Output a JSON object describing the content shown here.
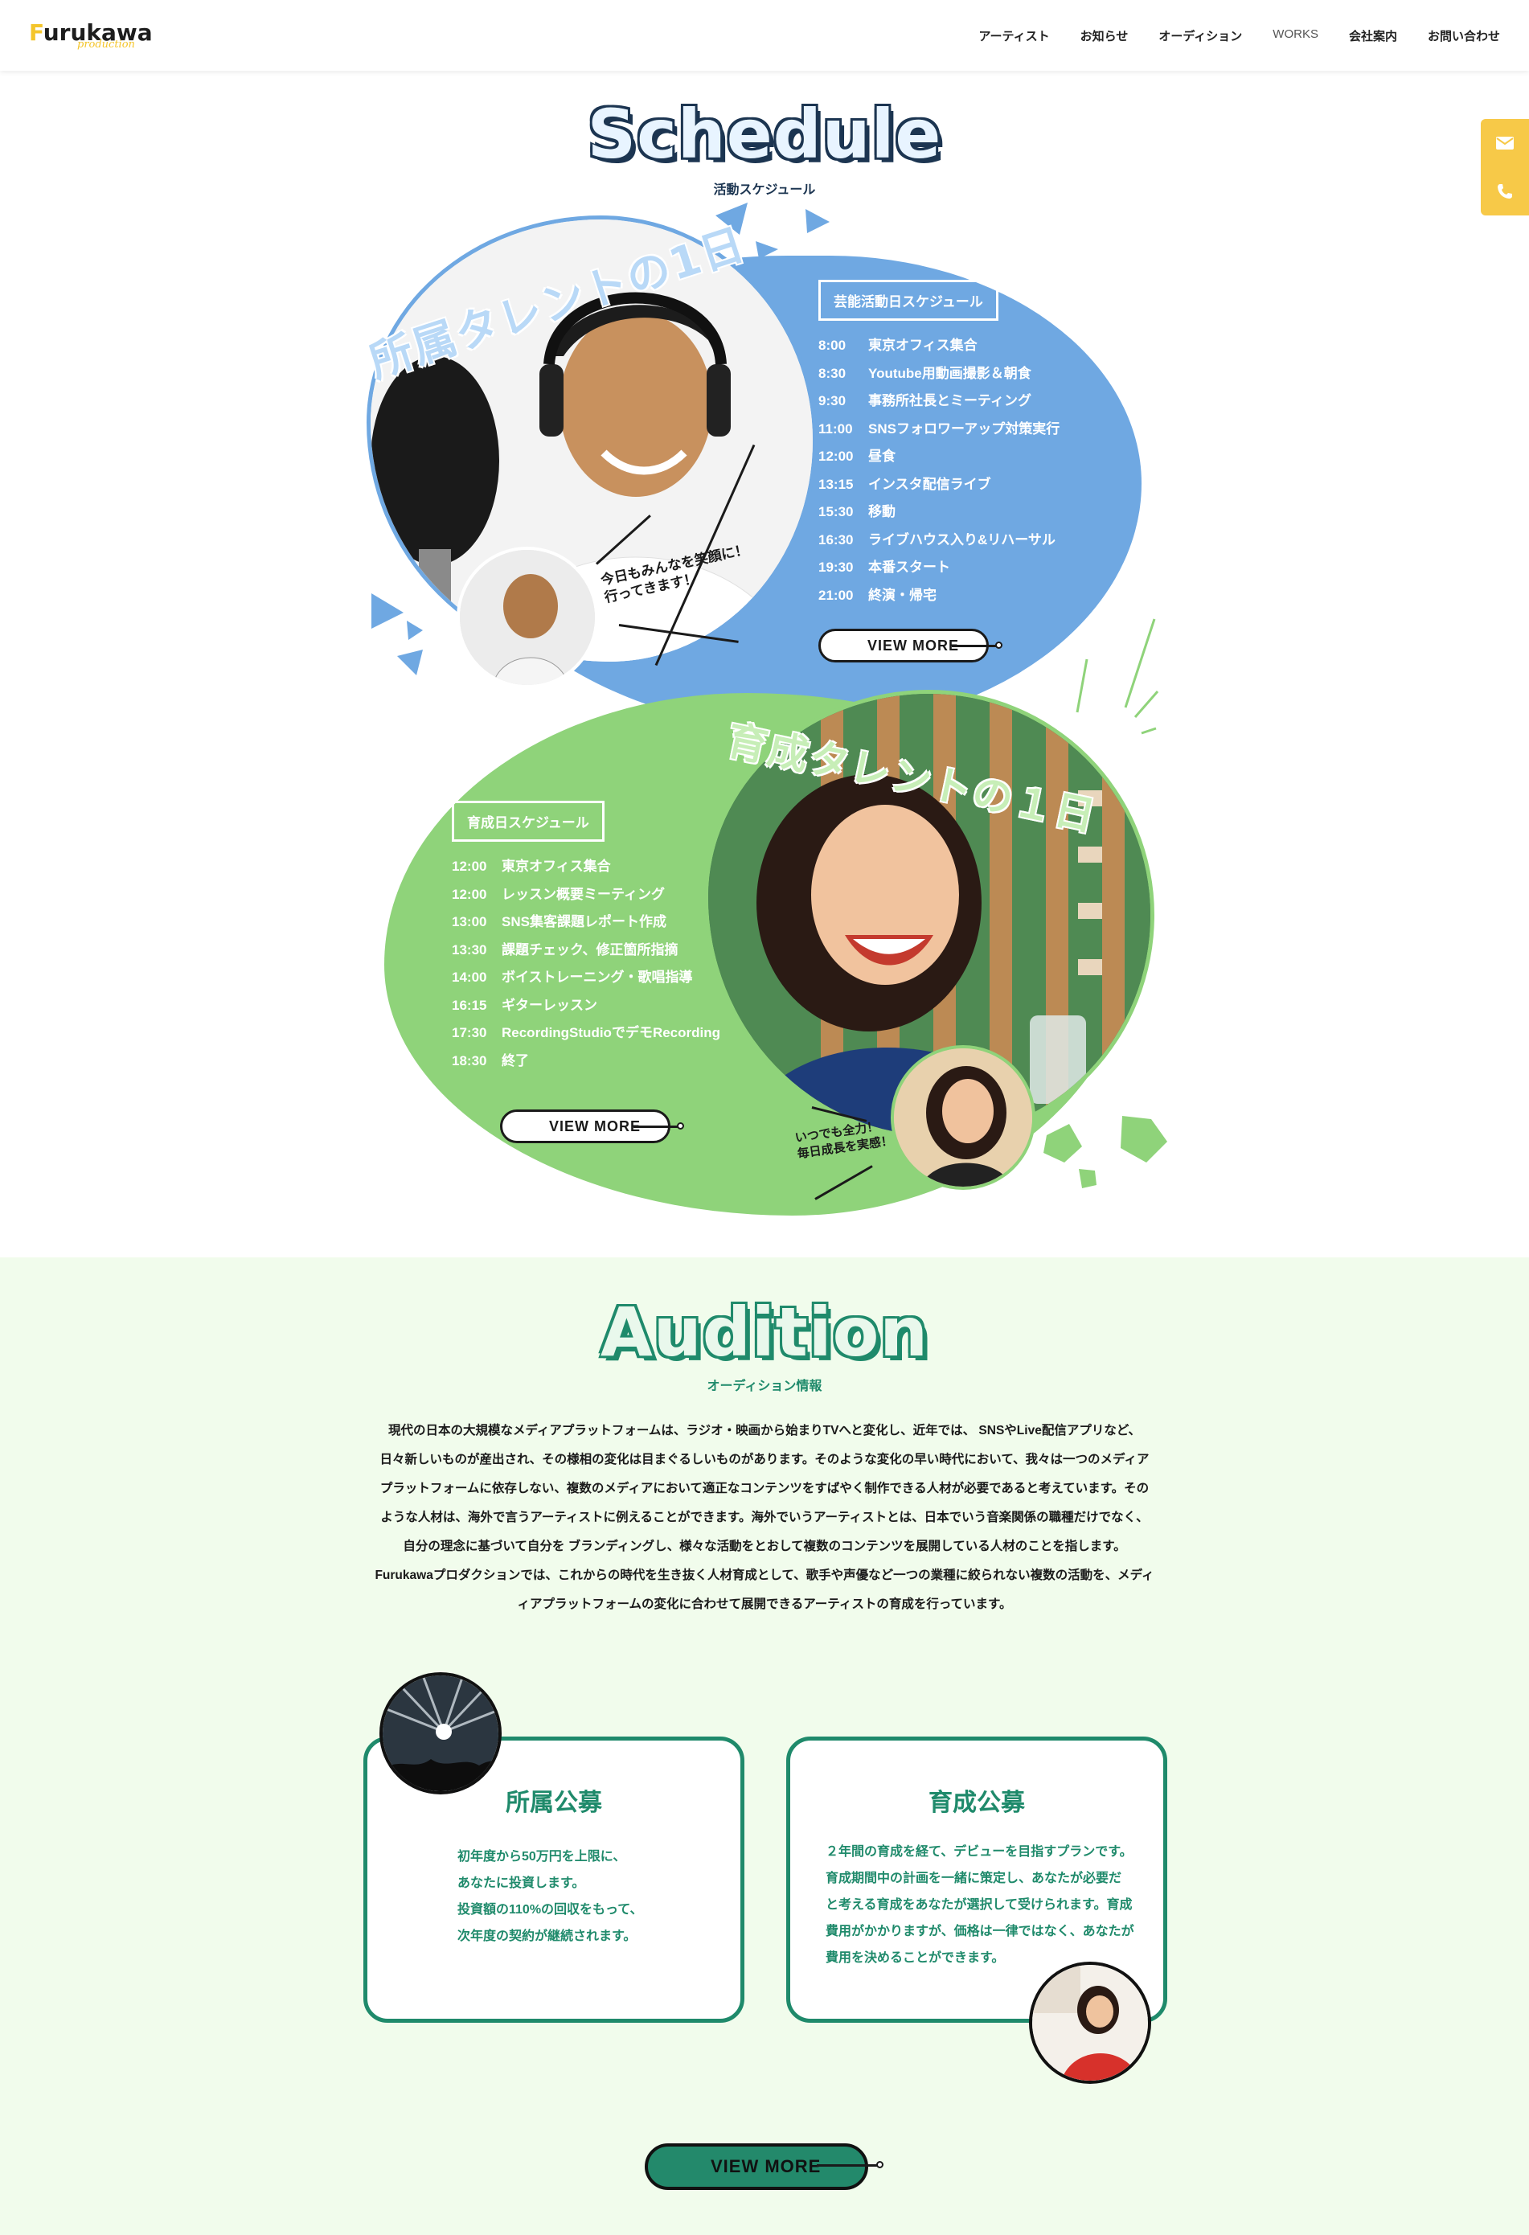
{
  "header": {
    "logo_text": "urukawa",
    "logo_initial": "F",
    "logo_sub": "production",
    "nav": [
      "アーティスト",
      "お知らせ",
      "オーディション",
      "WORKS",
      "会社案内",
      "お問い合わせ"
    ]
  },
  "side_tabs": {
    "mail_icon": "mail-icon",
    "phone_icon": "phone-icon"
  },
  "schedule": {
    "title": "Schedule",
    "subtitle": "活動スケジュール",
    "block1": {
      "headline": "所属タレントの1日",
      "label": "芸能活動日スケジュール",
      "items": [
        {
          "time": "8:00",
          "text": "東京オフィス集合"
        },
        {
          "time": "8:30",
          "text": "Youtube用動画撮影＆朝食"
        },
        {
          "time": "9:30",
          "text": "事務所社長とミーティング"
        },
        {
          "time": "11:00",
          "text": "SNSフォロワーアップ対策実行"
        },
        {
          "time": "12:00",
          "text": "昼食"
        },
        {
          "time": "13:15",
          "text": "インスタ配信ライブ"
        },
        {
          "time": "15:30",
          "text": "移動"
        },
        {
          "time": "16:30",
          "text": "ライブハウス入り&リハーサル"
        },
        {
          "time": "19:30",
          "text": "本番スタート"
        },
        {
          "time": "21:00",
          "text": "終演・帰宅"
        }
      ],
      "speech_line1": "今日もみんなを笑顔に！",
      "speech_line2": "行ってきます！",
      "view_more": "VIEW MORE"
    },
    "block2": {
      "headline": "育成タレントの１日",
      "label": "育成日スケジュール",
      "items": [
        {
          "time": "12:00",
          "text": "東京オフィス集合"
        },
        {
          "time": "12:00",
          "text": "レッスン概要ミーティング"
        },
        {
          "time": "13:00",
          "text": "SNS集客課題レポート作成"
        },
        {
          "time": "13:30",
          "text": "課題チェック、修正箇所指摘"
        },
        {
          "time": "14:00",
          "text": "ボイストレーニング・歌唱指導"
        },
        {
          "time": "16:15",
          "text": "ギターレッスン"
        },
        {
          "time": "17:30",
          "text": "RecordingStudioでデモRecording"
        },
        {
          "time": "18:30",
          "text": "終了"
        }
      ],
      "speech_line1": "いつでも全力！",
      "speech_line2": "毎日成長を実感！",
      "view_more": "VIEW MORE"
    }
  },
  "audition": {
    "title": "Audition",
    "subtitle": "オーディション情報",
    "body": [
      "現代の日本の大規模なメディアプラットフォームは、ラジオ・映画から始まりTVへと変化し、近年では、 SNSやLive配信アプリなど、",
      "日々新しいものが産出され、その様相の変化は目まぐるしいものがあります。そのような変化の早い時代において、我々は一つのメディア",
      "プラットフォームに依存しない、複数のメディアにおいて適正なコンテンツをすばやく制作できる人材が必要であると考えています。その",
      "ような人材は、海外で言うアーティストに例えることができます。海外でいうアーティストとは、日本でいう音楽関係の職種だけでなく、",
      "自分の理念に基づいて自分を ブランディングし、様々な活動をとおして複数のコンテンツを展開している人材のことを指します。",
      "Furukawaプロダクションでは、これからの時代を生き抜く人材育成として、歌手や声優など一つの業種に絞られない複数の活動を、メディ",
      "ィアプラットフォームの変化に合わせて展開できるアーティストの育成を行っています。"
    ],
    "card1": {
      "title": "所属公募",
      "lines": [
        "初年度から50万円を上限に、",
        "あなたに投資します。",
        "投資額の110%の回収をもって、",
        "次年度の契約が継続されます。"
      ]
    },
    "card2": {
      "title": "育成公募",
      "lines": [
        "２年間の育成を経て、デビューを目指すプランです。",
        "育成期間中の計画を一緒に策定し、あなたが必要だ",
        "と考える育成をあなたが選択して受けられます。育成",
        "費用がかかりますが、価格は一律ではなく、あなたが",
        "費用を決めることができます。"
      ]
    },
    "view_more": "VIEW MORE"
  },
  "colors": {
    "accent_yellow": "#f7c948",
    "schedule_blue": "#6fa8e2",
    "schedule_green": "#8fd37a",
    "audition_green": "#1f8a6b",
    "audition_bg": "#f1fcec"
  }
}
